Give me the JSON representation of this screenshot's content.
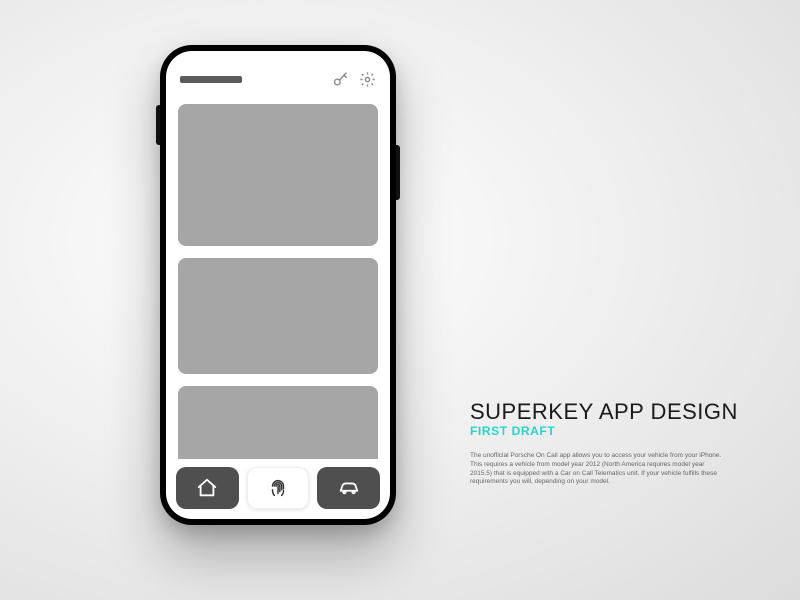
{
  "title_block": {
    "main": "SUPERKEY APP DESIGN",
    "subtitle": "FIRST DRAFT",
    "body": "The unofficial Porsche On Call app allows you to access your vehicle from your iPhone. This requires a vehicle from model year 2012 (North America requires model year 2015.5) that is equipped with a Car on Call Telematics unit. If your vehicle fulfills these requirements you will, depending on your model."
  },
  "colors": {
    "accent": "#23d7c8",
    "card": "#a6a6a6",
    "nav_dark": "#4f4f4f"
  }
}
